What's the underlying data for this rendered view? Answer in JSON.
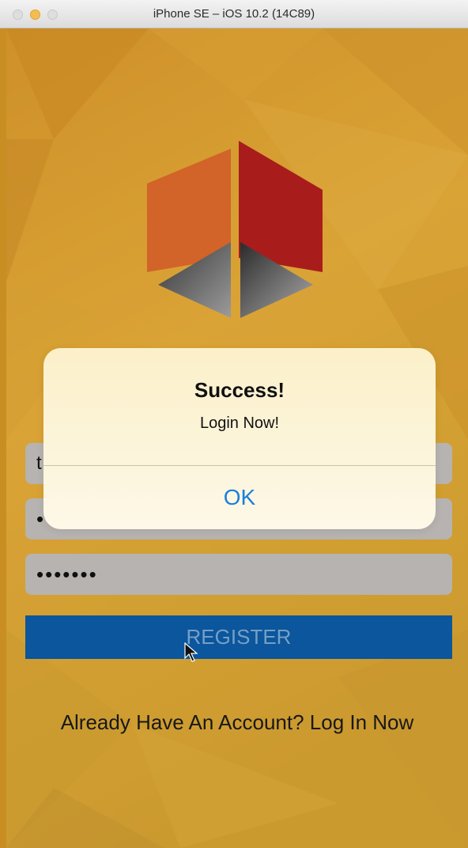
{
  "window": {
    "title": "iPhone SE – iOS 10.2 (14C89)"
  },
  "colors": {
    "background": "#e3a735",
    "field": "#c2bfbb",
    "register_button": "#0c5ca6",
    "register_text": "#7ea9d3",
    "alert_button": "#1a7fd9",
    "logo_orange": "#e06a2c",
    "logo_red": "#b41e1e"
  },
  "form": {
    "username_value": "t",
    "email_value": "•",
    "password_value": "•••••••",
    "register_label": "REGISTER",
    "login_link": "Already Have An Account? Log In Now"
  },
  "alert": {
    "title": "Success!",
    "message": "Login Now!",
    "ok_label": "OK"
  },
  "icons": {
    "logo": "cube-logo-icon",
    "cursor": "mouse-pointer-icon"
  }
}
